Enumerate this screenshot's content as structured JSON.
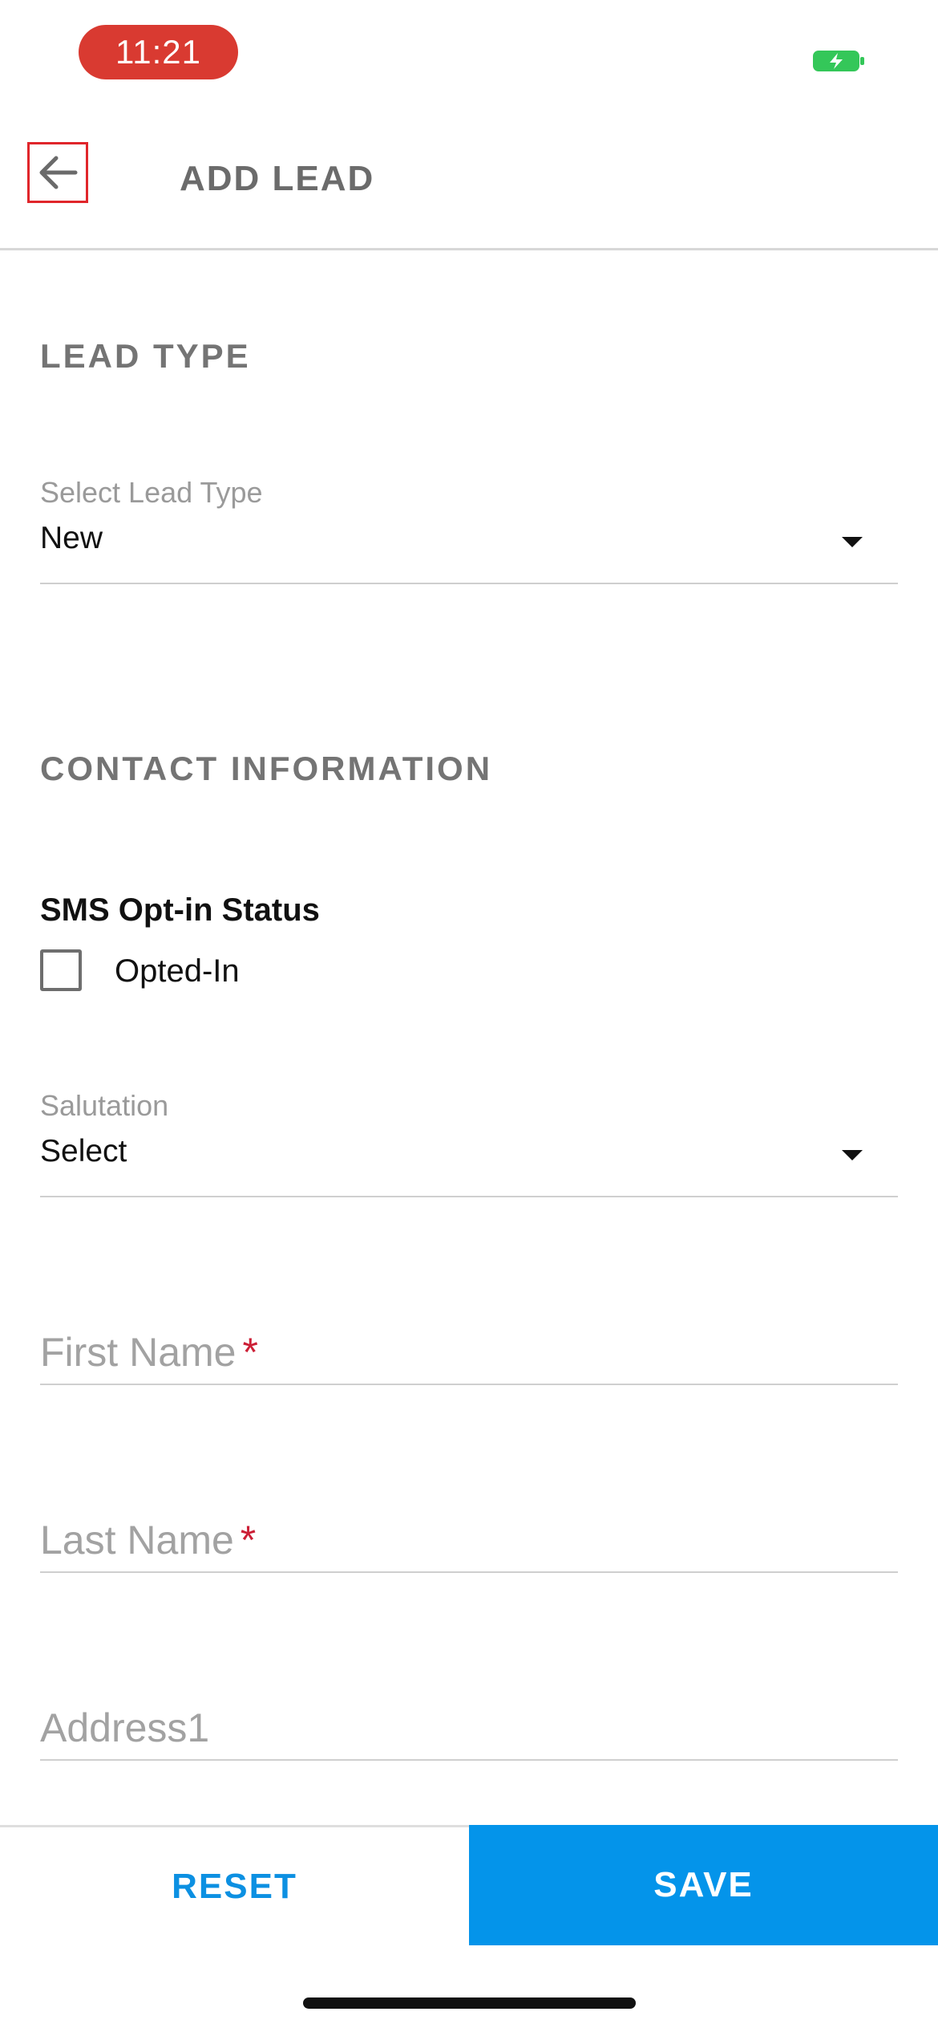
{
  "status_bar": {
    "time": "11:21",
    "time_pill_color": "#d93a31",
    "battery_icon": "battery-charging-icon",
    "battery_color": "#34c759"
  },
  "header": {
    "back_icon": "back-arrow-icon",
    "title": "ADD LEAD"
  },
  "lead_type_section": {
    "heading": "LEAD TYPE",
    "select_label": "Select Lead Type",
    "select_value": "New"
  },
  "contact_section": {
    "heading": "CONTACT INFORMATION",
    "sms_status_label": "SMS Opt-in Status",
    "opted_in_label": "Opted-In",
    "opted_in_checked": false,
    "salutation_label": "Salutation",
    "salutation_value": "Select",
    "first_name_placeholder": "First Name",
    "last_name_placeholder": "Last Name",
    "address1_placeholder": "Address1",
    "required_marker": "*",
    "required_color": "#cc1f36"
  },
  "actions": {
    "reset_label": "RESET",
    "save_label": "SAVE",
    "accent_color": "#0494ea"
  }
}
